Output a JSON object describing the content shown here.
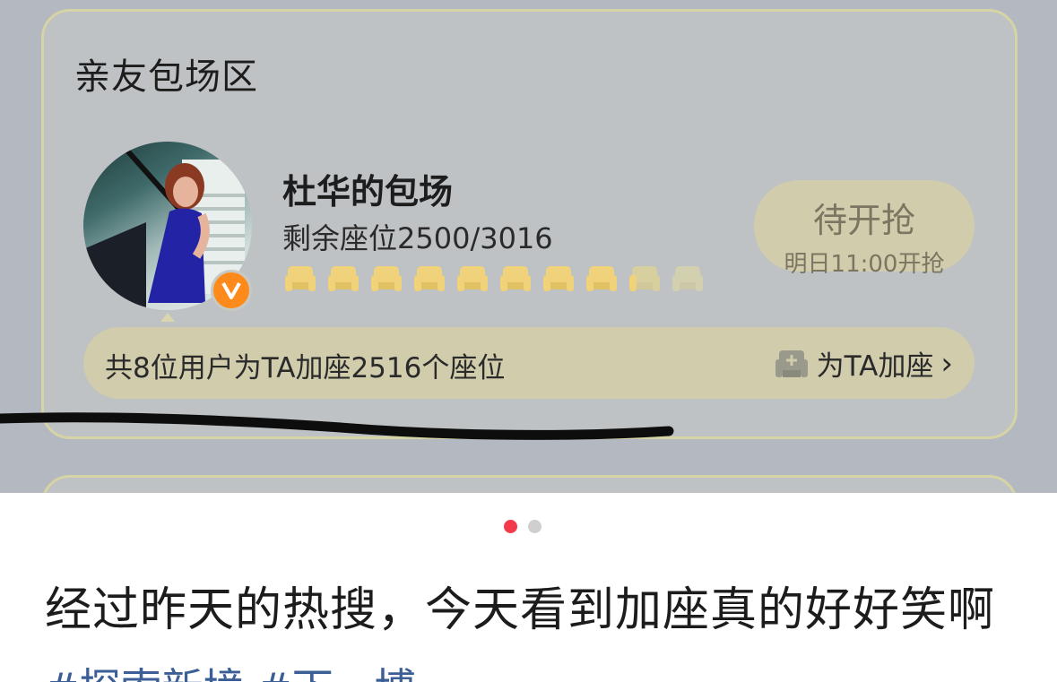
{
  "card": {
    "section_title": "亲友包场区",
    "host_name": "杜华的包场",
    "remaining_seats": "剩余座位2500/3016",
    "badge": "V",
    "seat_icons": {
      "filled": 8,
      "fading": 2,
      "color": "#f0d27a"
    },
    "status_button": {
      "label": "待开抢",
      "subtitle": "明日11:00开抢"
    },
    "summary": "共8位用户为TA加座2516个座位",
    "add_seat_label": "为TA加座",
    "add_seat_chevron": "›"
  },
  "carousel": {
    "active_index": 1,
    "total": 2,
    "active_color": "#f23a4a"
  },
  "post": {
    "text": "经过昨天的热搜，今天看到加座真的好好笑啊",
    "hashtags": "#探索新境 #下一博"
  }
}
